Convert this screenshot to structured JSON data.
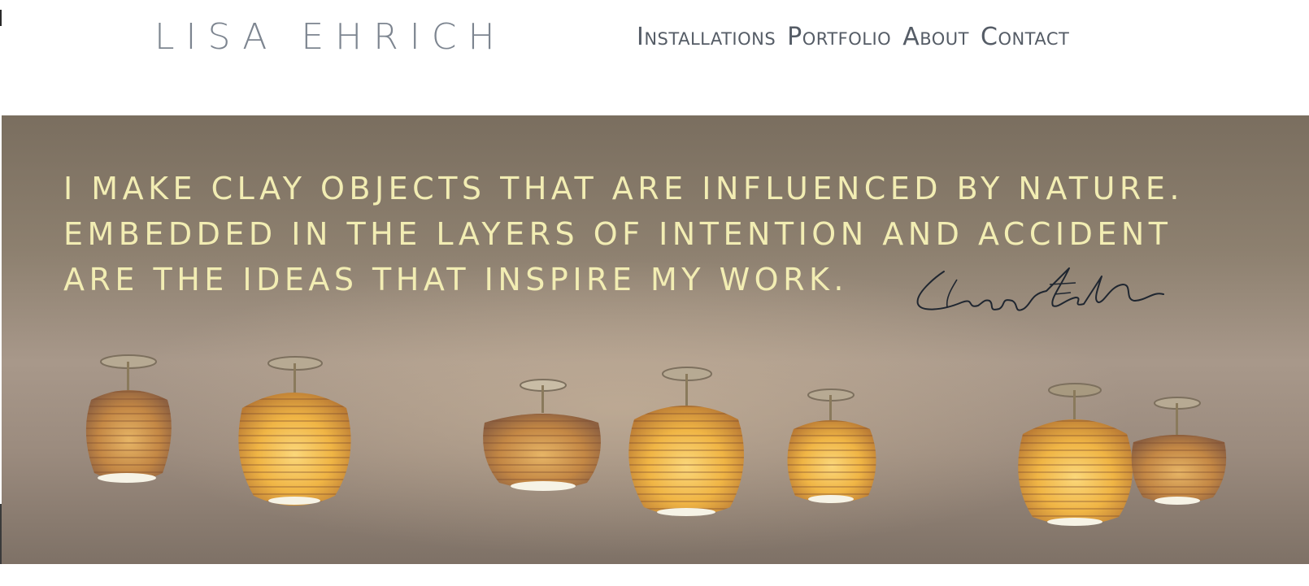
{
  "site": {
    "logo": "LISA EHRICH"
  },
  "nav": {
    "items": [
      "Installations",
      "Portfolio",
      "About",
      "Contact"
    ]
  },
  "hero": {
    "quote_lines": [
      "I make clay objects that are influenced by nature.",
      "Embedded in the layers of intention and accident",
      "are the ideas that inspire my work."
    ],
    "signature": "Lisa Ehrich",
    "image": "hanging pendant lamps"
  },
  "colors": {
    "logo": "#7d8590",
    "nav": "#555c66",
    "quote": "#f2edb3",
    "lamp_glow": "#f0b545"
  }
}
